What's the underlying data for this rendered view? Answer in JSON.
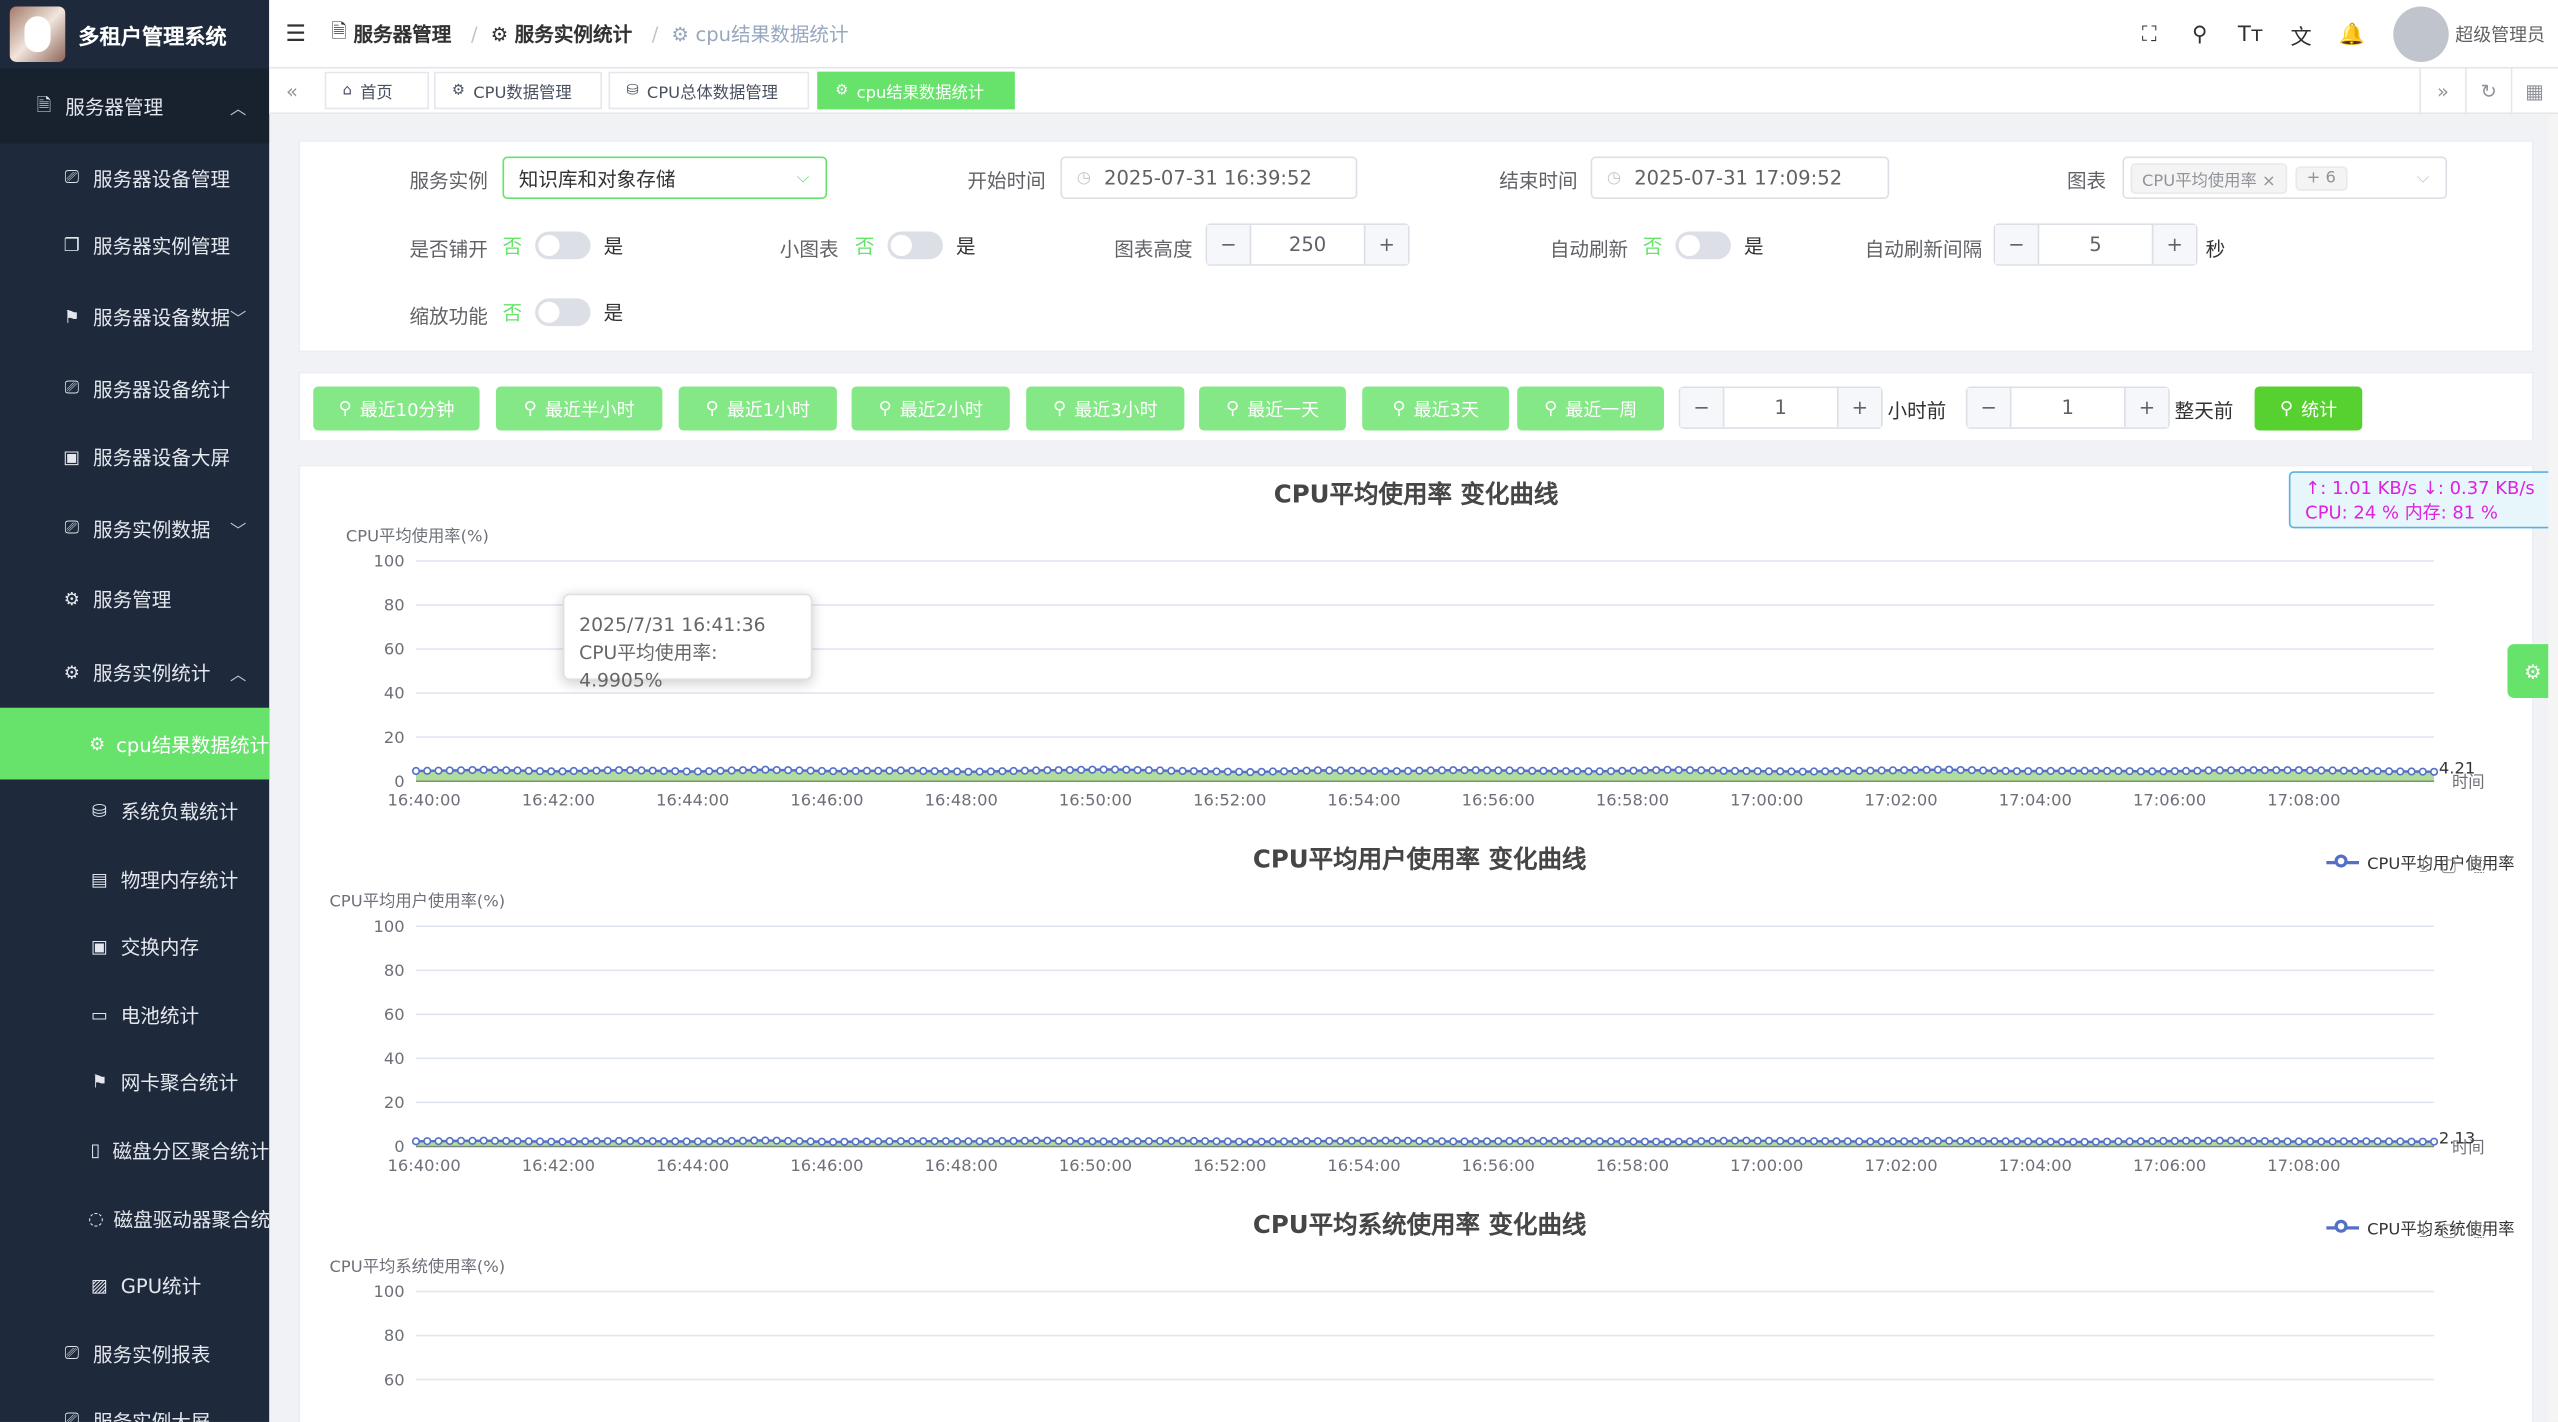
{
  "app": {
    "title": "多租户管理系统"
  },
  "sidebar": {
    "top": {
      "label": "服务器管理",
      "icon": "server-icon"
    },
    "items": [
      {
        "label": "服务器设备管理",
        "icon": "monitor-icon"
      },
      {
        "label": "服务器实例管理",
        "icon": "copy-icon"
      },
      {
        "label": "服务器设备数据",
        "icon": "pin-icon"
      },
      {
        "label": "服务器设备统计",
        "icon": "monitor-icon"
      },
      {
        "label": "服务器设备大屏",
        "icon": "calendar-icon"
      },
      {
        "label": "服务实例数据",
        "icon": "monitor-icon"
      },
      {
        "label": "服务管理",
        "icon": "cpu-icon"
      },
      {
        "label": "服务实例统计",
        "icon": "cpu-icon"
      },
      {
        "label": "cpu结果数据统计",
        "icon": "cpu-icon"
      },
      {
        "label": "系统负载统计",
        "icon": "database-icon"
      },
      {
        "label": "物理内存统计",
        "icon": "memory-icon"
      },
      {
        "label": "交换内存",
        "icon": "calendar-icon"
      },
      {
        "label": "电池统计",
        "icon": "battery-icon"
      },
      {
        "label": "网卡聚合统计",
        "icon": "pin-icon"
      },
      {
        "label": "磁盘分区聚合统计",
        "icon": "disk-icon"
      },
      {
        "label": "磁盘驱动器聚合统计",
        "icon": "bulb-icon"
      },
      {
        "label": "GPU统计",
        "icon": "gpu-icon"
      },
      {
        "label": "服务实例报表",
        "icon": "monitor-icon"
      },
      {
        "label": "服务实例大屏",
        "icon": "monitor-icon"
      }
    ]
  },
  "header": {
    "breadcrumb": [
      "服务器管理",
      "服务实例统计",
      "cpu结果数据统计"
    ],
    "user": "超级管理员"
  },
  "tabs": [
    "首页",
    "CPU数据管理",
    "CPU总体数据管理",
    "cpu结果数据统计"
  ],
  "filters": {
    "instance_label": "服务实例",
    "instance_value": "知识库和对象存储",
    "start_label": "开始时间",
    "start_value": "2025-07-31 16:39:52",
    "end_label": "结束时间",
    "end_value": "2025-07-31 17:09:52",
    "chart_label": "图表",
    "chart_tag": "CPU平均使用率",
    "chart_more": "+ 6",
    "tile_label": "是否铺开",
    "small_label": "小图表",
    "height_label": "图表高度",
    "height_value": "250",
    "refresh_label": "自动刷新",
    "interval_label": "自动刷新间隔",
    "interval_value": "5",
    "interval_unit": "秒",
    "zoom_label": "缩放功能",
    "no": "否",
    "yes": "是"
  },
  "quick": {
    "buttons": [
      "最近10分钟",
      "最近半小时",
      "最近1小时",
      "最近2小时",
      "最近3小时",
      "最近一天",
      "最近3天",
      "最近一周"
    ],
    "hours_value": "1",
    "hours_suffix": "小时前",
    "days_value": "1",
    "days_suffix": "整天前",
    "stat": "统计"
  },
  "netmon": {
    "line1": "↑: 1.01 KB/s ↓: 0.37 KB/s",
    "line2": "CPU: 24 %    内存: 81 %"
  },
  "tooltip": {
    "time": "2025/7/31 16:41:36",
    "text": "CPU平均使用率: 4.9905%"
  },
  "chart_data": [
    {
      "type": "line",
      "title": "CPU平均使用率 变化曲线",
      "ylabel": "CPU平均使用率(%)",
      "xlabel": "时间",
      "ylim": [
        0,
        100
      ],
      "yticks": [
        "0",
        "20",
        "40",
        "60",
        "80",
        "100"
      ],
      "x": [
        "16:40:00",
        "16:42:00",
        "16:44:00",
        "16:46:00",
        "16:48:00",
        "16:50:00",
        "16:52:00",
        "16:54:00",
        "16:56:00",
        "16:58:00",
        "17:00:00",
        "17:02:00",
        "17:04:00",
        "17:06:00",
        "17:08:00"
      ],
      "series": [
        {
          "values": [
            4.6,
            5.1,
            4.4,
            5.0,
            4.3,
            5.2,
            4.5,
            4.8,
            4.2,
            4.9,
            5.3,
            4.6,
            4.1,
            4.9,
            4.5,
            5.0,
            4.7,
            4.4,
            5.1,
            4.6,
            4.3,
            4.8,
            5.2,
            4.5,
            4.7,
            4.4,
            4.9,
            5.0,
            4.6,
            4.21
          ],
          "last_label": "4.21"
        }
      ],
      "legend": false
    },
    {
      "type": "line",
      "title": "CPU平均用户使用率 变化曲线",
      "ylabel": "CPU平均用户使用率(%)",
      "xlabel": "时间",
      "ylim": [
        0,
        100
      ],
      "yticks": [
        "0",
        "20",
        "40",
        "60",
        "80",
        "100"
      ],
      "x": [
        "16:40:00",
        "16:42:00",
        "16:44:00",
        "16:46:00",
        "16:48:00",
        "16:50:00",
        "16:52:00",
        "16:54:00",
        "16:56:00",
        "16:58:00",
        "17:00:00",
        "17:02:00",
        "17:04:00",
        "17:06:00",
        "17:08:00"
      ],
      "series": [
        {
          "name": "CPU平均用户使用率",
          "values": [
            2.3,
            2.6,
            2.1,
            2.5,
            2.2,
            2.7,
            2.0,
            2.4,
            2.3,
            2.6,
            2.2,
            2.5,
            2.1,
            2.4,
            2.6,
            2.2,
            2.5,
            2.3,
            2.1,
            2.6,
            2.4,
            2.2,
            2.5,
            2.3,
            2.0,
            2.4,
            2.6,
            2.2,
            2.3,
            2.13
          ],
          "last_label": "2.13"
        }
      ],
      "legend": true
    },
    {
      "type": "line",
      "title": "CPU平均系统使用率 变化曲线",
      "ylabel": "CPU平均系统使用率(%)",
      "ylim": [
        0,
        100
      ],
      "yticks": [
        "60",
        "80",
        "100"
      ],
      "series": [
        {
          "name": "CPU平均系统使用率"
        }
      ],
      "legend": true
    }
  ],
  "colors": {
    "accent": "#67e26b",
    "series": "#5470c6",
    "sidebar": "#1e2a3c"
  }
}
